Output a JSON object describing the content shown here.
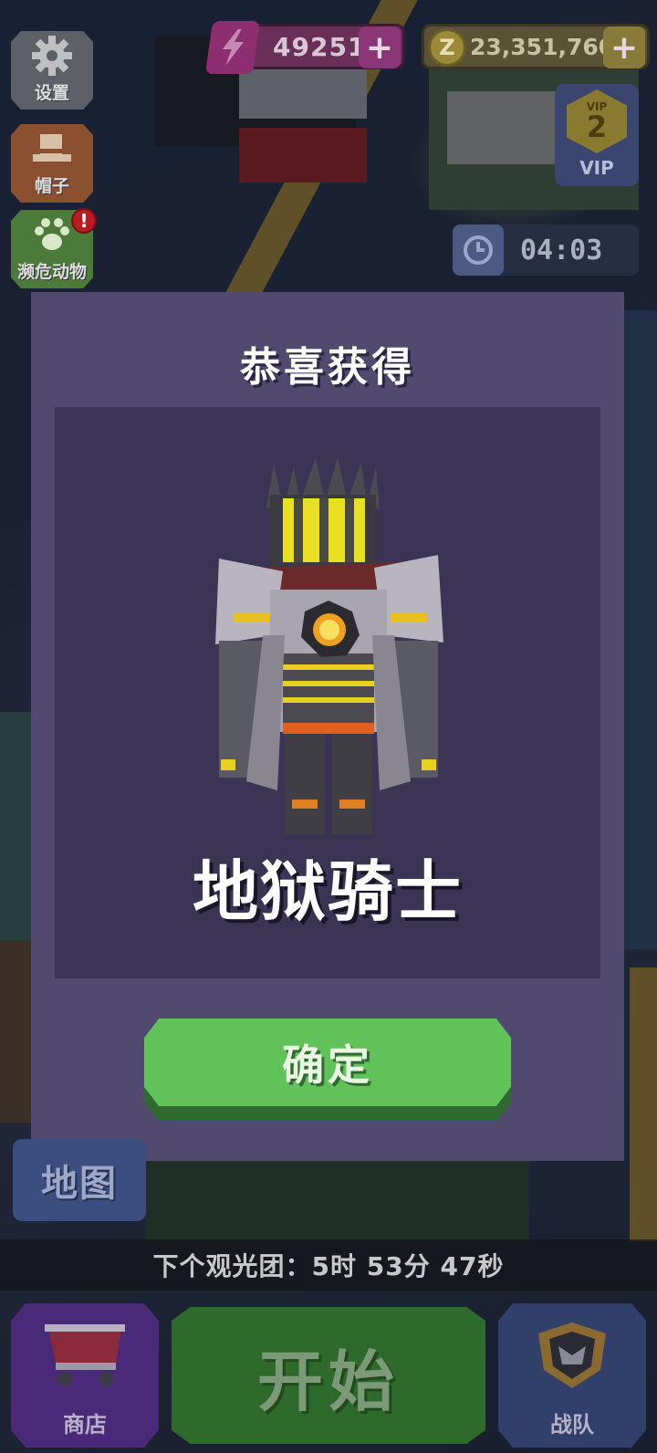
{
  "hud": {
    "energy_value": "49251",
    "coin_value": "23,351,760",
    "plus_label": "+",
    "coin_symbol": "Z",
    "vip_small": "VIP",
    "vip_level": "2",
    "vip_label": "VIP",
    "timer_value": "04:03"
  },
  "side_menu": {
    "settings_label": "设置",
    "hat_label": "帽子",
    "pet_label": "濒危动物",
    "pet_badge": "!"
  },
  "modal": {
    "title": "恭喜获得",
    "reward_name": "地狱骑士",
    "confirm_label": "确定"
  },
  "bottom": {
    "map_label": "地图",
    "next_tour_text": "下个观光团：5时 53分 47秒",
    "shop_label": "商店",
    "start_label": "开始",
    "team_label": "战队"
  },
  "icons": {
    "energy": "lightning-icon",
    "coin": "coin-icon",
    "settings": "gear-icon",
    "hat": "hat-icon",
    "pet": "paw-icon",
    "timer": "clock-icon",
    "shop": "cart-icon",
    "team": "shield-icon"
  },
  "colors": {
    "modal_bg": "#524a6e",
    "panel_bg": "#3b3455",
    "confirm_green": "#62c25a",
    "badge_red": "#b81c22"
  }
}
